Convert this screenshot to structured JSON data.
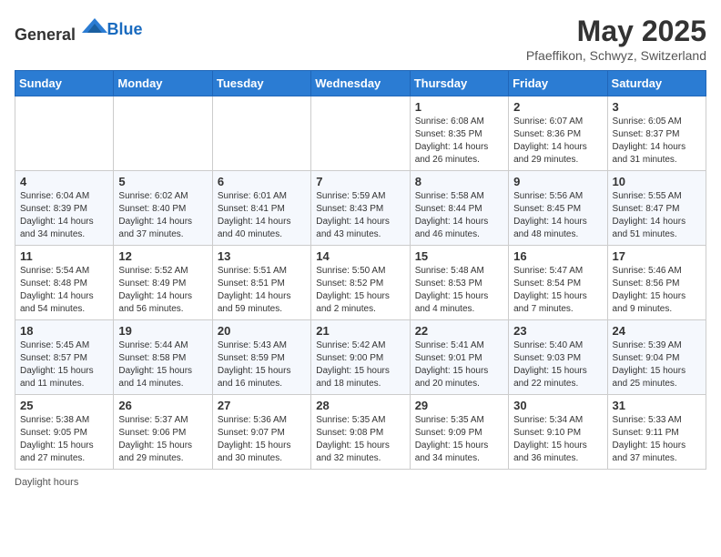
{
  "header": {
    "logo_general": "General",
    "logo_blue": "Blue",
    "month": "May 2025",
    "location": "Pfaeffikon, Schwyz, Switzerland"
  },
  "days_of_week": [
    "Sunday",
    "Monday",
    "Tuesday",
    "Wednesday",
    "Thursday",
    "Friday",
    "Saturday"
  ],
  "weeks": [
    [
      {
        "day": "",
        "info": ""
      },
      {
        "day": "",
        "info": ""
      },
      {
        "day": "",
        "info": ""
      },
      {
        "day": "",
        "info": ""
      },
      {
        "day": "1",
        "info": "Sunrise: 6:08 AM\nSunset: 8:35 PM\nDaylight: 14 hours and 26 minutes."
      },
      {
        "day": "2",
        "info": "Sunrise: 6:07 AM\nSunset: 8:36 PM\nDaylight: 14 hours and 29 minutes."
      },
      {
        "day": "3",
        "info": "Sunrise: 6:05 AM\nSunset: 8:37 PM\nDaylight: 14 hours and 31 minutes."
      }
    ],
    [
      {
        "day": "4",
        "info": "Sunrise: 6:04 AM\nSunset: 8:39 PM\nDaylight: 14 hours and 34 minutes."
      },
      {
        "day": "5",
        "info": "Sunrise: 6:02 AM\nSunset: 8:40 PM\nDaylight: 14 hours and 37 minutes."
      },
      {
        "day": "6",
        "info": "Sunrise: 6:01 AM\nSunset: 8:41 PM\nDaylight: 14 hours and 40 minutes."
      },
      {
        "day": "7",
        "info": "Sunrise: 5:59 AM\nSunset: 8:43 PM\nDaylight: 14 hours and 43 minutes."
      },
      {
        "day": "8",
        "info": "Sunrise: 5:58 AM\nSunset: 8:44 PM\nDaylight: 14 hours and 46 minutes."
      },
      {
        "day": "9",
        "info": "Sunrise: 5:56 AM\nSunset: 8:45 PM\nDaylight: 14 hours and 48 minutes."
      },
      {
        "day": "10",
        "info": "Sunrise: 5:55 AM\nSunset: 8:47 PM\nDaylight: 14 hours and 51 minutes."
      }
    ],
    [
      {
        "day": "11",
        "info": "Sunrise: 5:54 AM\nSunset: 8:48 PM\nDaylight: 14 hours and 54 minutes."
      },
      {
        "day": "12",
        "info": "Sunrise: 5:52 AM\nSunset: 8:49 PM\nDaylight: 14 hours and 56 minutes."
      },
      {
        "day": "13",
        "info": "Sunrise: 5:51 AM\nSunset: 8:51 PM\nDaylight: 14 hours and 59 minutes."
      },
      {
        "day": "14",
        "info": "Sunrise: 5:50 AM\nSunset: 8:52 PM\nDaylight: 15 hours and 2 minutes."
      },
      {
        "day": "15",
        "info": "Sunrise: 5:48 AM\nSunset: 8:53 PM\nDaylight: 15 hours and 4 minutes."
      },
      {
        "day": "16",
        "info": "Sunrise: 5:47 AM\nSunset: 8:54 PM\nDaylight: 15 hours and 7 minutes."
      },
      {
        "day": "17",
        "info": "Sunrise: 5:46 AM\nSunset: 8:56 PM\nDaylight: 15 hours and 9 minutes."
      }
    ],
    [
      {
        "day": "18",
        "info": "Sunrise: 5:45 AM\nSunset: 8:57 PM\nDaylight: 15 hours and 11 minutes."
      },
      {
        "day": "19",
        "info": "Sunrise: 5:44 AM\nSunset: 8:58 PM\nDaylight: 15 hours and 14 minutes."
      },
      {
        "day": "20",
        "info": "Sunrise: 5:43 AM\nSunset: 8:59 PM\nDaylight: 15 hours and 16 minutes."
      },
      {
        "day": "21",
        "info": "Sunrise: 5:42 AM\nSunset: 9:00 PM\nDaylight: 15 hours and 18 minutes."
      },
      {
        "day": "22",
        "info": "Sunrise: 5:41 AM\nSunset: 9:01 PM\nDaylight: 15 hours and 20 minutes."
      },
      {
        "day": "23",
        "info": "Sunrise: 5:40 AM\nSunset: 9:03 PM\nDaylight: 15 hours and 22 minutes."
      },
      {
        "day": "24",
        "info": "Sunrise: 5:39 AM\nSunset: 9:04 PM\nDaylight: 15 hours and 25 minutes."
      }
    ],
    [
      {
        "day": "25",
        "info": "Sunrise: 5:38 AM\nSunset: 9:05 PM\nDaylight: 15 hours and 27 minutes."
      },
      {
        "day": "26",
        "info": "Sunrise: 5:37 AM\nSunset: 9:06 PM\nDaylight: 15 hours and 29 minutes."
      },
      {
        "day": "27",
        "info": "Sunrise: 5:36 AM\nSunset: 9:07 PM\nDaylight: 15 hours and 30 minutes."
      },
      {
        "day": "28",
        "info": "Sunrise: 5:35 AM\nSunset: 9:08 PM\nDaylight: 15 hours and 32 minutes."
      },
      {
        "day": "29",
        "info": "Sunrise: 5:35 AM\nSunset: 9:09 PM\nDaylight: 15 hours and 34 minutes."
      },
      {
        "day": "30",
        "info": "Sunrise: 5:34 AM\nSunset: 9:10 PM\nDaylight: 15 hours and 36 minutes."
      },
      {
        "day": "31",
        "info": "Sunrise: 5:33 AM\nSunset: 9:11 PM\nDaylight: 15 hours and 37 minutes."
      }
    ]
  ],
  "footer": {
    "daylight_label": "Daylight hours"
  }
}
